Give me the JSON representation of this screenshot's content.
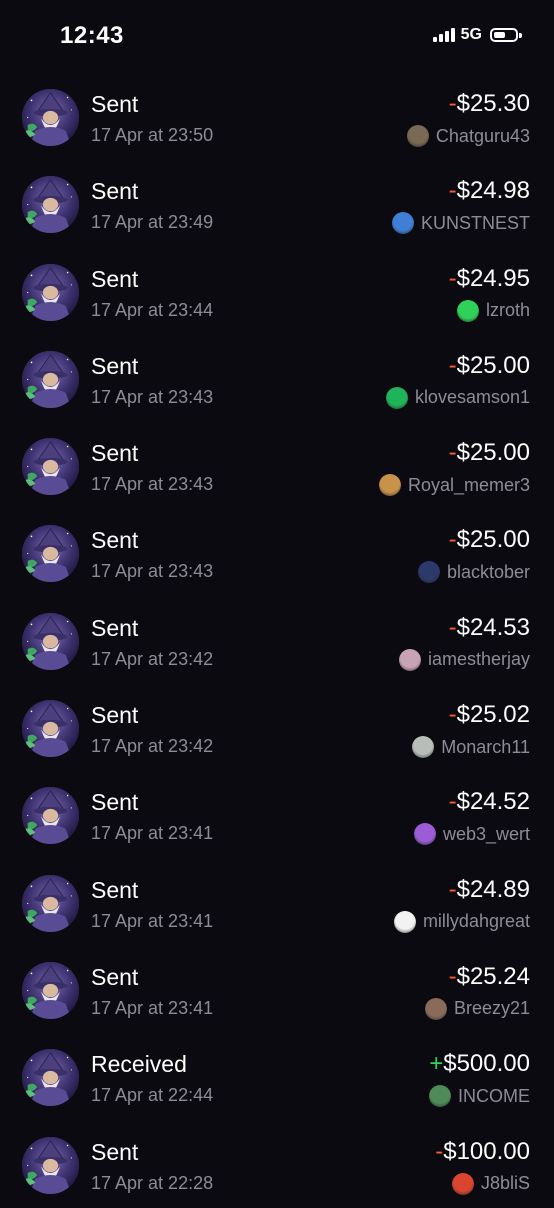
{
  "status_bar": {
    "time": "12:43",
    "network": "5G",
    "battery_level": 0.55
  },
  "colors": {
    "background": "#0b0a10",
    "negative_sign": "#ff5a2e",
    "positive_sign": "#2fd158",
    "secondary_text": "#8e8b96"
  },
  "transactions": [
    {
      "type": "Sent",
      "date": "17 Apr at 23:50",
      "sign": "-",
      "amount": "$25.30",
      "user": "Chatguru43",
      "user_icon": "avatar-chatguru43-icon",
      "icon_color": "#7a6a55"
    },
    {
      "type": "Sent",
      "date": "17 Apr at 23:49",
      "sign": "-",
      "amount": "$24.98",
      "user": "KUNSTNEST",
      "user_icon": "avatar-kunstnest-icon",
      "icon_color": "#3f7fd6"
    },
    {
      "type": "Sent",
      "date": "17 Apr at 23:44",
      "sign": "-",
      "amount": "$24.95",
      "user": "lzroth",
      "user_icon": "avatar-lzroth-icon",
      "icon_color": "#2fd158"
    },
    {
      "type": "Sent",
      "date": "17 Apr at 23:43",
      "sign": "-",
      "amount": "$25.00",
      "user": "klovesamson1",
      "user_icon": "avatar-klovesamson1-icon",
      "icon_color": "#1fb35a"
    },
    {
      "type": "Sent",
      "date": "17 Apr at 23:43",
      "sign": "-",
      "amount": "$25.00",
      "user": "Royal_memer3",
      "user_icon": "avatar-royal-memer3-icon",
      "icon_color": "#c9924a"
    },
    {
      "type": "Sent",
      "date": "17 Apr at 23:43",
      "sign": "-",
      "amount": "$25.00",
      "user": "blacktober",
      "user_icon": "avatar-blacktober-icon",
      "icon_color": "#2b3a6a"
    },
    {
      "type": "Sent",
      "date": "17 Apr at 23:42",
      "sign": "-",
      "amount": "$24.53",
      "user": "iamestherjay",
      "user_icon": "avatar-iamestherjay-icon",
      "icon_color": "#c9a3b5"
    },
    {
      "type": "Sent",
      "date": "17 Apr at 23:42",
      "sign": "-",
      "amount": "$25.02",
      "user": "Monarch11",
      "user_icon": "avatar-monarch11-icon",
      "icon_color": "#b8bdb9"
    },
    {
      "type": "Sent",
      "date": "17 Apr at 23:41",
      "sign": "-",
      "amount": "$24.52",
      "user": "web3_wert",
      "user_icon": "avatar-web3-wert-icon",
      "icon_color": "#9b5cd6"
    },
    {
      "type": "Sent",
      "date": "17 Apr at 23:41",
      "sign": "-",
      "amount": "$24.89",
      "user": "millydahgreat",
      "user_icon": "avatar-millydahgreat-icon",
      "icon_color": "#f2f2f2"
    },
    {
      "type": "Sent",
      "date": "17 Apr at 23:41",
      "sign": "-",
      "amount": "$25.24",
      "user": "Breezy21",
      "user_icon": "avatar-breezy21-icon",
      "icon_color": "#8a6b5a"
    },
    {
      "type": "Received",
      "date": "17 Apr at 22:44",
      "sign": "+",
      "amount": "$500.00",
      "user": "INCOME",
      "user_icon": "avatar-income-icon",
      "icon_color": "#4e8a5a"
    },
    {
      "type": "Sent",
      "date": "17 Apr at 22:28",
      "sign": "-",
      "amount": "$100.00",
      "user": "J8bliS",
      "user_icon": "avatar-j8blis-icon",
      "icon_color": "#d9452e"
    }
  ]
}
